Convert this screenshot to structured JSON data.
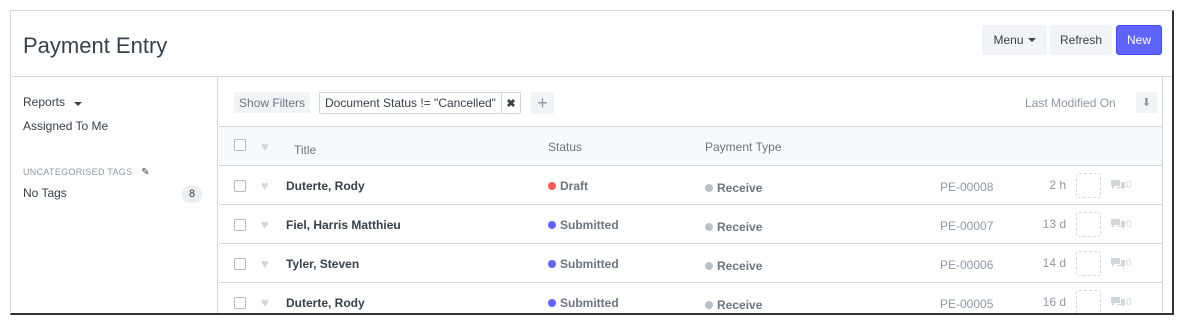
{
  "page": {
    "title": "Payment Entry"
  },
  "toolbar": {
    "menu_label": "Menu",
    "refresh_label": "Refresh",
    "new_label": "New"
  },
  "sidebar": {
    "reports_label": "Reports",
    "assigned_label": "Assigned To Me",
    "tags_section_label": "UNCATEGORISED TAGS",
    "no_tags_label": "No Tags",
    "no_tags_count": "8"
  },
  "filters": {
    "show_filters_label": "Show Filters",
    "active_filter": "Document Status != \"Cancelled\"",
    "sort_label": "Last Modified On"
  },
  "list": {
    "columns": {
      "title": "Title",
      "status": "Status",
      "payment_type": "Payment Type"
    },
    "rows": [
      {
        "title": "Duterte, Rody",
        "status": "Draft",
        "status_color": "#ff5858",
        "payment_type": "Receive",
        "name": "PE-00008",
        "modified": "2 h",
        "comments": "0"
      },
      {
        "title": "Fiel, Harris Matthieu",
        "status": "Submitted",
        "status_color": "#5e64ff",
        "payment_type": "Receive",
        "name": "PE-00007",
        "modified": "13 d",
        "comments": "0"
      },
      {
        "title": "Tyler, Steven",
        "status": "Submitted",
        "status_color": "#5e64ff",
        "payment_type": "Receive",
        "name": "PE-00006",
        "modified": "14 d",
        "comments": "0"
      },
      {
        "title": "Duterte, Rody",
        "status": "Submitted",
        "status_color": "#5e64ff",
        "payment_type": "Receive",
        "name": "PE-00005",
        "modified": "16 d",
        "comments": "0"
      }
    ],
    "ptype_color": "#b8c2cc"
  }
}
